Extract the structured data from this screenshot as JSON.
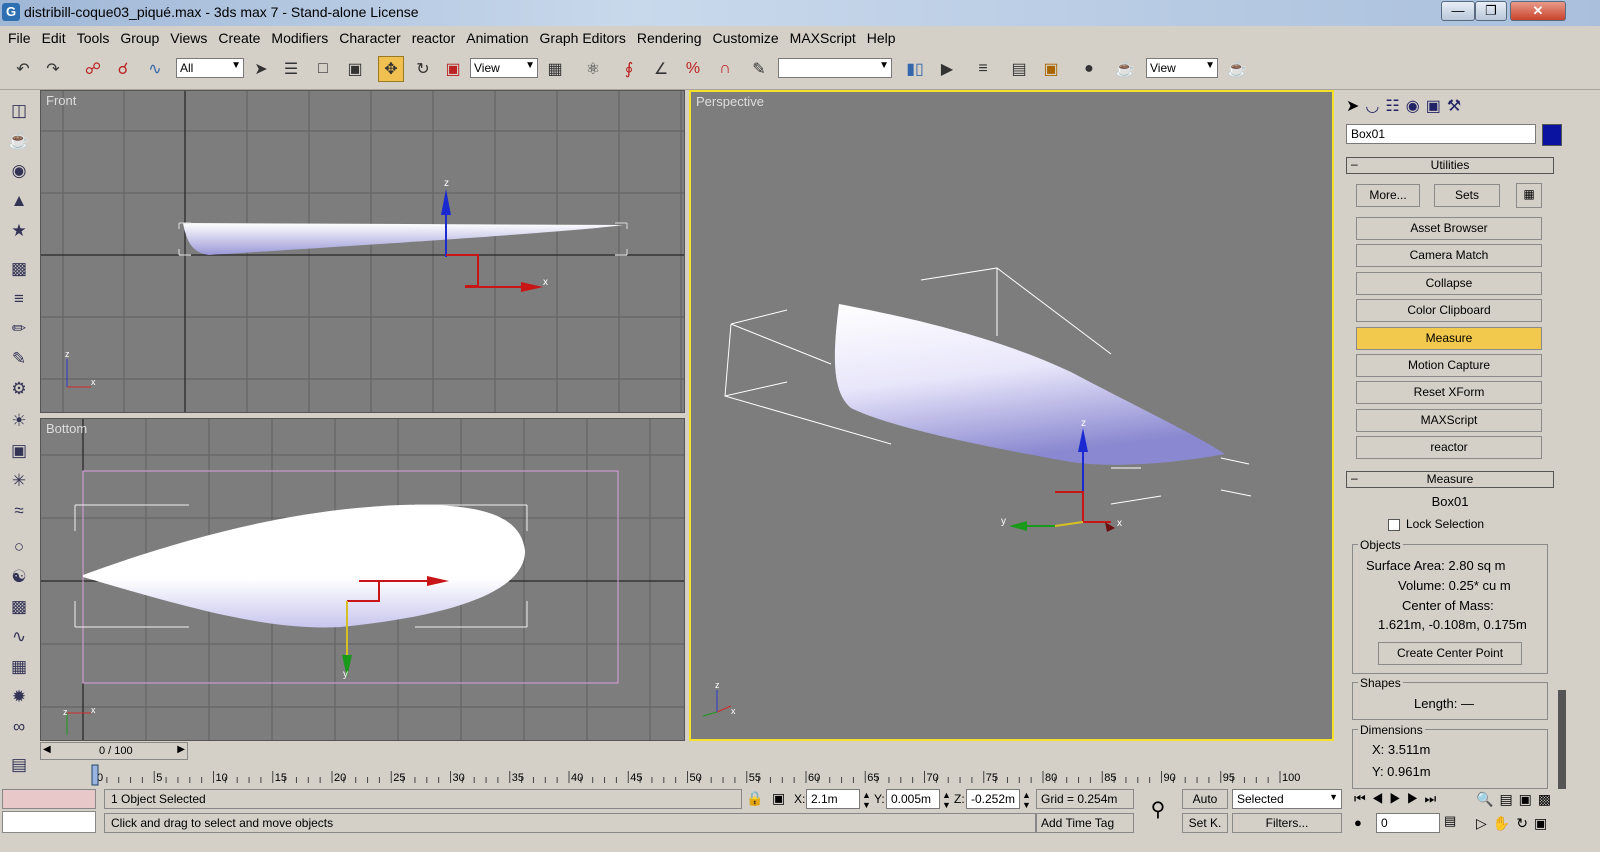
{
  "window": {
    "title": "distribill-coque03_piqué.max - 3ds max 7 - Stand-alone License",
    "app_icon": "G"
  },
  "menu": [
    "File",
    "Edit",
    "Tools",
    "Group",
    "Views",
    "Create",
    "Modifiers",
    "Character",
    "reactor",
    "Animation",
    "Graph Editors",
    "Rendering",
    "Customize",
    "MAXScript",
    "Help"
  ],
  "toolbar": {
    "selection_filter": "All",
    "ref_coord": "View",
    "named_sel": "",
    "view_coord2": "View"
  },
  "viewports": {
    "front": "Front",
    "bottom": "Bottom",
    "perspective": "Perspective"
  },
  "command_panel": {
    "object_name": "Box01",
    "object_color": "#0a12a0",
    "utilities_title": "Utilities",
    "more_label": "More...",
    "sets_label": "Sets",
    "utility_buttons": [
      "Asset Browser",
      "Camera Match",
      "Collapse",
      "Color Clipboard",
      "Measure",
      "Motion Capture",
      "Reset XForm",
      "MAXScript",
      "reactor"
    ],
    "active_utility": "Measure",
    "measure_title": "Measure",
    "measure_object": "Box01",
    "lock_selection": "Lock Selection",
    "objects_group": "Objects",
    "surface_area": "Surface Area:  2.80 sq m",
    "volume": "Volume:  0.25* cu m",
    "center_label": "Center of Mass:",
    "center_value": "1.621m, -0.108m, 0.175m",
    "create_center": "Create Center Point",
    "shapes_group": "Shapes",
    "length": "Length:  —",
    "dimensions_group": "Dimensions",
    "dim_x": "X:   3.511m",
    "dim_y": "Y:   0.961m"
  },
  "timeline": {
    "counter": "0 / 100",
    "ticks": [
      "0",
      "5",
      "10",
      "15",
      "20",
      "25",
      "30",
      "35",
      "40",
      "45",
      "50",
      "55",
      "60",
      "65",
      "70",
      "75",
      "80",
      "85",
      "90",
      "95",
      "100"
    ]
  },
  "status": {
    "objects_selected": "1 Object Selected",
    "prompt": "Click and drag to select and move objects",
    "x_label": "X:",
    "x_value": "2.1m",
    "y_label": "Y:",
    "y_value": "0.005m",
    "z_label": "Z:",
    "z_value": "-0.252m",
    "grid": "Grid = 0.254m",
    "add_time_tag": "Add Time Tag",
    "auto_key": "Auto",
    "set_key": "Set K.",
    "key_mode": "Selected",
    "filters": "Filters...",
    "frame": "0"
  }
}
